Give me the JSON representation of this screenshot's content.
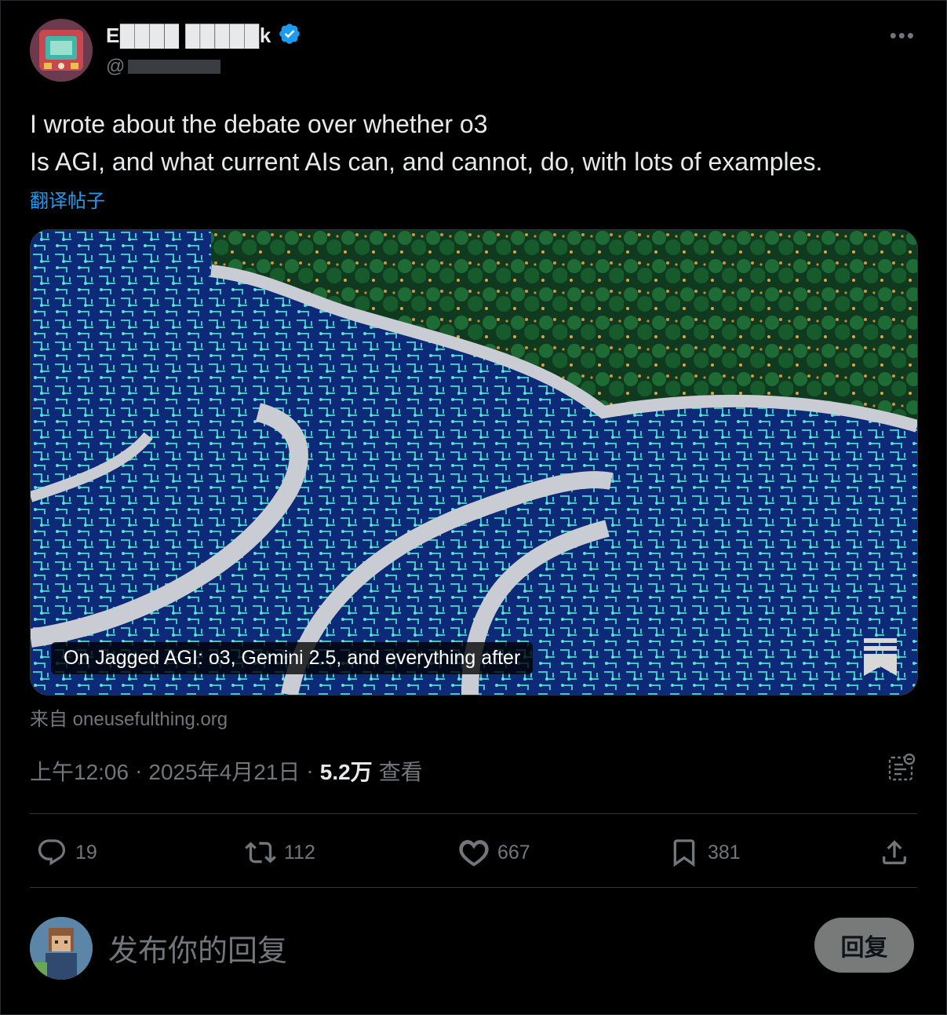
{
  "author": {
    "name": "E████ █████k",
    "handle_prefix": "@",
    "verified": true
  },
  "more_label": "•••",
  "tweet": {
    "line1": "I wrote about the debate over whether o3",
    "line2": "Is AGI, and what current AIs can, and cannot, do, with lots of examples."
  },
  "translate_label": "翻译帖子",
  "card": {
    "caption": "On Jagged AGI: o3, Gemini 2.5, and everything after",
    "source": "来自 oneusefulthing.org"
  },
  "meta": {
    "time": "上午12:06",
    "sep1": "·",
    "date": "2025年4月21日",
    "sep2": "·",
    "views": "5.2万",
    "views_label": "查看"
  },
  "actions": {
    "replies": "19",
    "reposts": "112",
    "likes": "667",
    "bookmarks": "381"
  },
  "reply_box": {
    "placeholder": "发布你的回复",
    "button": "回复"
  },
  "colors": {
    "background": "#000000",
    "text": "#e7e9ea",
    "muted": "#71767b",
    "link": "#1d9bf0",
    "verified": "#1d9bf0"
  }
}
